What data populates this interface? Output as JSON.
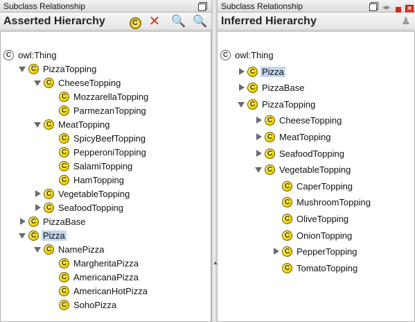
{
  "left": {
    "title": "Subclass Relationship",
    "header": "Asserted Hierarchy",
    "toolbar": {
      "add_subclass_icon": "add-subclass-icon",
      "delete_icon": "delete-class-icon",
      "find_icon": "find-class-icon",
      "find_usage_icon": "find-usage-icon",
      "view_icon": "window-view-icon"
    },
    "tree": [
      {
        "label": "owl:Thing",
        "indent": 0,
        "toggle": "none",
        "icon": "thing"
      },
      {
        "label": "PizzaTopping",
        "indent": 1,
        "toggle": "open",
        "icon": "class"
      },
      {
        "label": "CheeseTopping",
        "indent": 2,
        "toggle": "open",
        "icon": "class"
      },
      {
        "label": "MozzarellaTopping",
        "indent": 3,
        "toggle": "none",
        "icon": "class"
      },
      {
        "label": "ParmezanTopping",
        "indent": 3,
        "toggle": "none",
        "icon": "class"
      },
      {
        "label": "MeatTopping",
        "indent": 2,
        "toggle": "open",
        "icon": "class"
      },
      {
        "label": "SpicyBeefTopping",
        "indent": 3,
        "toggle": "none",
        "icon": "class"
      },
      {
        "label": "PepperoniTopping",
        "indent": 3,
        "toggle": "none",
        "icon": "class"
      },
      {
        "label": "SalamiTopping",
        "indent": 3,
        "toggle": "none",
        "icon": "class"
      },
      {
        "label": "HamTopping",
        "indent": 3,
        "toggle": "none",
        "icon": "class"
      },
      {
        "label": "VegetableTopping",
        "indent": 2,
        "toggle": "closed",
        "icon": "class"
      },
      {
        "label": "SeafoodTopping",
        "indent": 2,
        "toggle": "closed",
        "icon": "class"
      },
      {
        "label": "PizzaBase",
        "indent": 1,
        "toggle": "closed",
        "icon": "class"
      },
      {
        "label": "Pizza",
        "indent": 1,
        "toggle": "open",
        "icon": "class",
        "selected": true
      },
      {
        "label": "NamePizza",
        "indent": 2,
        "toggle": "open",
        "icon": "class"
      },
      {
        "label": "MargheritaPizza",
        "indent": 3,
        "toggle": "none",
        "icon": "class"
      },
      {
        "label": "AmericanaPizza",
        "indent": 3,
        "toggle": "none",
        "icon": "class"
      },
      {
        "label": "AmericanHotPizza",
        "indent": 3,
        "toggle": "none",
        "icon": "class"
      },
      {
        "label": "SohoPizza",
        "indent": 3,
        "toggle": "none",
        "icon": "class"
      }
    ]
  },
  "right": {
    "title": "Subclass Relationship",
    "header": "Inferred Hierarchy",
    "window_icons": [
      "window-view-icon",
      "arrows-icon",
      "minimize-icon",
      "close-icon"
    ],
    "tree": [
      {
        "label": "owl:Thing",
        "indent": 0,
        "toggle": "none",
        "icon": "thing"
      },
      {
        "label": "Pizza",
        "indent": 1,
        "toggle": "closed",
        "icon": "class",
        "selected": true
      },
      {
        "label": "PizzaBase",
        "indent": 1,
        "toggle": "closed",
        "icon": "class"
      },
      {
        "label": "PizzaTopping",
        "indent": 1,
        "toggle": "open",
        "icon": "class"
      },
      {
        "label": "CheeseTopping",
        "indent": 2,
        "toggle": "closed",
        "icon": "class"
      },
      {
        "label": "MeatTopping",
        "indent": 2,
        "toggle": "closed",
        "icon": "class"
      },
      {
        "label": "SeafoodTopping",
        "indent": 2,
        "toggle": "closed",
        "icon": "class"
      },
      {
        "label": "VegetableTopping",
        "indent": 2,
        "toggle": "open",
        "icon": "class"
      },
      {
        "label": "CaperTopping",
        "indent": 3,
        "toggle": "none",
        "icon": "class"
      },
      {
        "label": "MushroomTopping",
        "indent": 3,
        "toggle": "none",
        "icon": "class"
      },
      {
        "label": "OliveTopping",
        "indent": 3,
        "toggle": "none",
        "icon": "class"
      },
      {
        "label": "OnionTopping",
        "indent": 3,
        "toggle": "none",
        "icon": "class"
      },
      {
        "label": "PepperTopping",
        "indent": 3,
        "toggle": "closed",
        "icon": "class"
      },
      {
        "label": "TomatoTopping",
        "indent": 3,
        "toggle": "none",
        "icon": "class"
      }
    ]
  },
  "class_icon_glyph": "C"
}
